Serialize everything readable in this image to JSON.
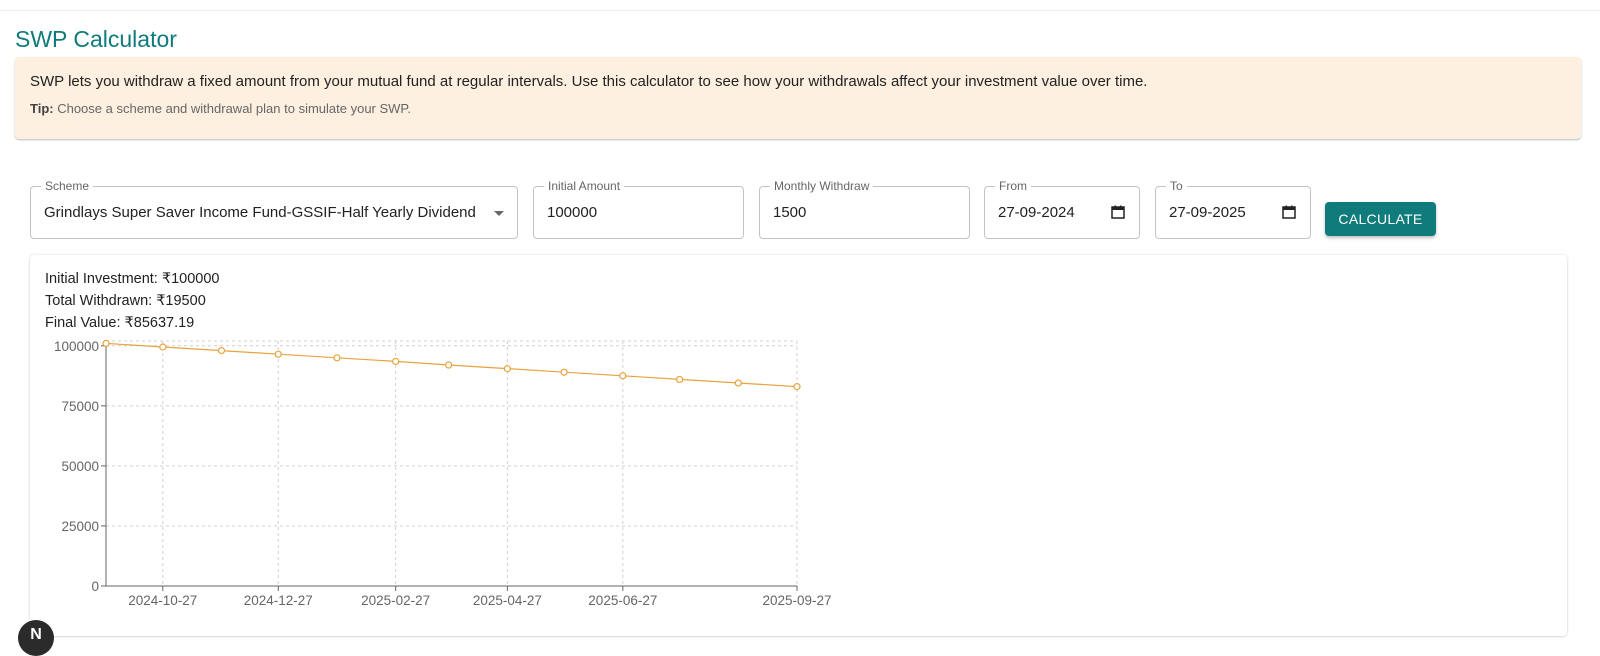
{
  "page": {
    "title": "SWP Calculator"
  },
  "info": {
    "main": "SWP lets you withdraw a fixed amount from your mutual fund at regular intervals. Use this calculator to see how your withdrawals affect your investment value over time.",
    "tip_label": "Tip:",
    "tip_text": " Choose a scheme and withdrawal plan to simulate your SWP."
  },
  "form": {
    "scheme_label": "Scheme",
    "scheme_value": "Grindlays Super Saver Income Fund-GSSIF-Half Yearly Dividend",
    "initial_label": "Initial Amount",
    "initial_value": "100000",
    "monthly_label": "Monthly Withdraw",
    "monthly_value": "1500",
    "from_label": "From",
    "from_value": "27-09-2024",
    "to_label": "To",
    "to_value": "27-09-2025",
    "calculate_label": "CALCULATE"
  },
  "summary": {
    "initial": "Initial Investment: ₹100000",
    "withdrawn": "Total Withdrawn: ₹19500",
    "final": "Final Value: ₹85637.19"
  },
  "fab": {
    "label": "N"
  },
  "icons": {
    "dropdown": "chevron-down-icon",
    "calendar": "calendar-icon"
  },
  "colors": {
    "accent": "#0f7b7b",
    "line": "#e8a33d",
    "info_bg": "#fdf0e1"
  },
  "chart_data": {
    "type": "line",
    "x": [
      "2024-09-27",
      "2024-10-27",
      "2024-11-27",
      "2024-12-27",
      "2025-01-27",
      "2025-02-27",
      "2025-03-27",
      "2025-04-27",
      "2025-05-27",
      "2025-06-27",
      "2025-07-27",
      "2025-08-27",
      "2025-09-27"
    ],
    "values": [
      101000,
      99500,
      98000,
      96500,
      95000,
      93500,
      92000,
      90500,
      89000,
      87500,
      86000,
      84500,
      83000
    ],
    "xticks": [
      "2024-10-27",
      "2024-12-27",
      "2025-02-27",
      "2025-04-27",
      "2025-06-27",
      "2025-09-27"
    ],
    "yticks": [
      0,
      25000,
      50000,
      75000,
      100000
    ],
    "ylim": [
      0,
      102000
    ],
    "grid": true,
    "line_color": "#e8a33d"
  }
}
